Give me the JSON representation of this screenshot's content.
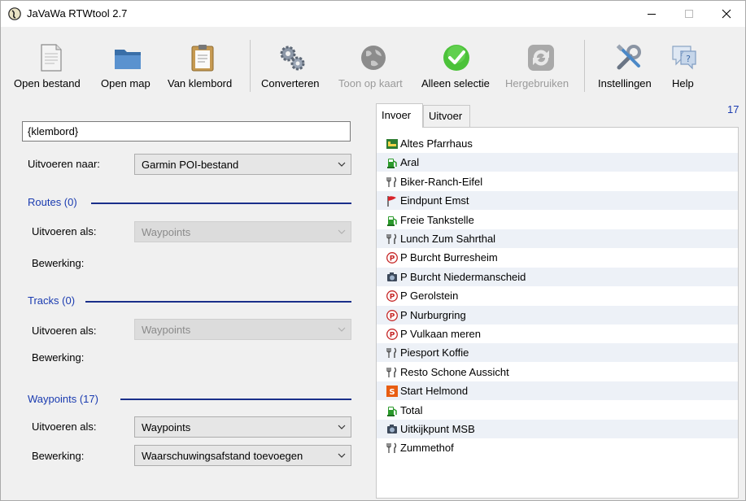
{
  "window": {
    "title": "JaVaWa RTWtool 2.7"
  },
  "toolbar": {
    "buttons": [
      {
        "label": "Open bestand",
        "icon": "document-icon",
        "enabled": true
      },
      {
        "label": "Open map",
        "icon": "folder-icon",
        "enabled": true
      },
      {
        "label": "Van klembord",
        "icon": "clipboard-icon",
        "enabled": true
      },
      {
        "label": "Converteren",
        "icon": "gears-icon",
        "enabled": true
      },
      {
        "label": "Toon op kaart",
        "icon": "globe-icon",
        "enabled": false
      },
      {
        "label": "Alleen selectie",
        "icon": "check-icon",
        "enabled": true
      },
      {
        "label": "Hergebruiken",
        "icon": "recycle-icon",
        "enabled": false
      },
      {
        "label": "Instellingen",
        "icon": "tools-icon",
        "enabled": true
      },
      {
        "label": "Help",
        "icon": "help-icon",
        "enabled": true
      }
    ]
  },
  "left": {
    "input_value": "{klembord}",
    "output_to_label": "Uitvoeren naar:",
    "output_to_value": "Garmin POI-bestand",
    "routes": {
      "title": "Routes (0)",
      "as_label": "Uitvoeren als:",
      "as_value": "Waypoints",
      "edit_label": "Bewerking:"
    },
    "tracks": {
      "title": "Tracks (0)",
      "as_label": "Uitvoeren als:",
      "as_value": "Waypoints",
      "edit_label": "Bewerking:"
    },
    "waypoints": {
      "title": "Waypoints (17)",
      "as_label": "Uitvoeren als:",
      "as_value": "Waypoints",
      "edit_label": "Bewerking:",
      "edit_value": "Waarschuwingsafstand toevoegen"
    }
  },
  "right": {
    "tabs": [
      "Invoer",
      "Uitvoer"
    ],
    "count": "17",
    "items": [
      {
        "label": "Altes Pfarrhaus",
        "icon": "lodging-icon"
      },
      {
        "label": "Aral",
        "icon": "fuel-icon"
      },
      {
        "label": "Biker-Ranch-Eifel",
        "icon": "restaurant-icon"
      },
      {
        "label": "Eindpunt Emst",
        "icon": "flag-icon"
      },
      {
        "label": "Freie Tankstelle",
        "icon": "fuel-icon"
      },
      {
        "label": "Lunch Zum Sahrthal",
        "icon": "restaurant-icon"
      },
      {
        "label": "P Burcht Burresheim",
        "icon": "parking-icon"
      },
      {
        "label": "P Burcht Niedermanscheid",
        "icon": "camera-icon"
      },
      {
        "label": "P Gerolstein",
        "icon": "parking-icon"
      },
      {
        "label": "P Nurburgring",
        "icon": "parking-icon"
      },
      {
        "label": "P Vulkaan meren",
        "icon": "parking-icon"
      },
      {
        "label": "Piesport Koffie",
        "icon": "restaurant-icon"
      },
      {
        "label": "Resto Schone Aussicht",
        "icon": "restaurant-icon"
      },
      {
        "label": "Start Helmond",
        "icon": "start-icon"
      },
      {
        "label": "Total",
        "icon": "fuel-icon"
      },
      {
        "label": "Uitkijkpunt MSB",
        "icon": "camera-icon"
      },
      {
        "label": "Zummethof",
        "icon": "restaurant-icon"
      }
    ]
  }
}
